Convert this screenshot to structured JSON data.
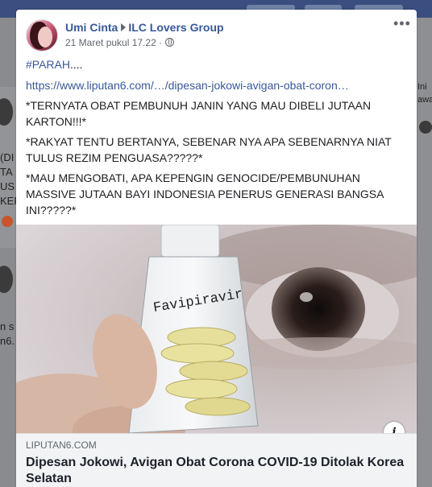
{
  "background": {
    "left_texts": [
      "(DI",
      "TA",
      "US I",
      "KEF",
      "n s",
      "n6."
    ],
    "right_texts": [
      "Ini",
      "awa"
    ]
  },
  "post": {
    "author": "Umi Cinta",
    "group": "ILC Lovers Group",
    "timestamp": "21 Maret pukul 17.22 ·",
    "privacy_icon": "globe-icon",
    "more_icon": "more-options-icon",
    "more_label": "•••",
    "hashtag": "#PARAH",
    "hashtag_suffix": "....",
    "link_text": "https://www.liputan6.com/…/dipesan-jokowi-avigan-obat-coron…",
    "paragraphs": [
      "*TERNYATA OBAT PEMBUNUH JANIN YANG MAU DIBELI JUTAAN KARTON!!!*",
      "*RAKYAT TENTU BERTANYA, SEBENAR NYA APA SEBENARNYA NIAT TULUS REZIM PENGUASA?????*",
      "*MAU MENGOBATI, APA KEPENGIN GENOCIDE/PEMBUNUHAN MASSIVE JUTAAN BAYI INDONESIA PENERUS GENERASI BANGSA INI?????*"
    ]
  },
  "image": {
    "vial_label": "Favipiravir",
    "info_label": "i"
  },
  "link_preview": {
    "domain": "LIPUTAN6.COM",
    "title": "Dipesan Jokowi, Avigan Obat Corona COVID-19 Ditolak Korea Selatan"
  },
  "colors": {
    "link": "#385898",
    "text": "#1c1e21",
    "meta": "#616770",
    "preview_bg": "#f2f3f5"
  }
}
